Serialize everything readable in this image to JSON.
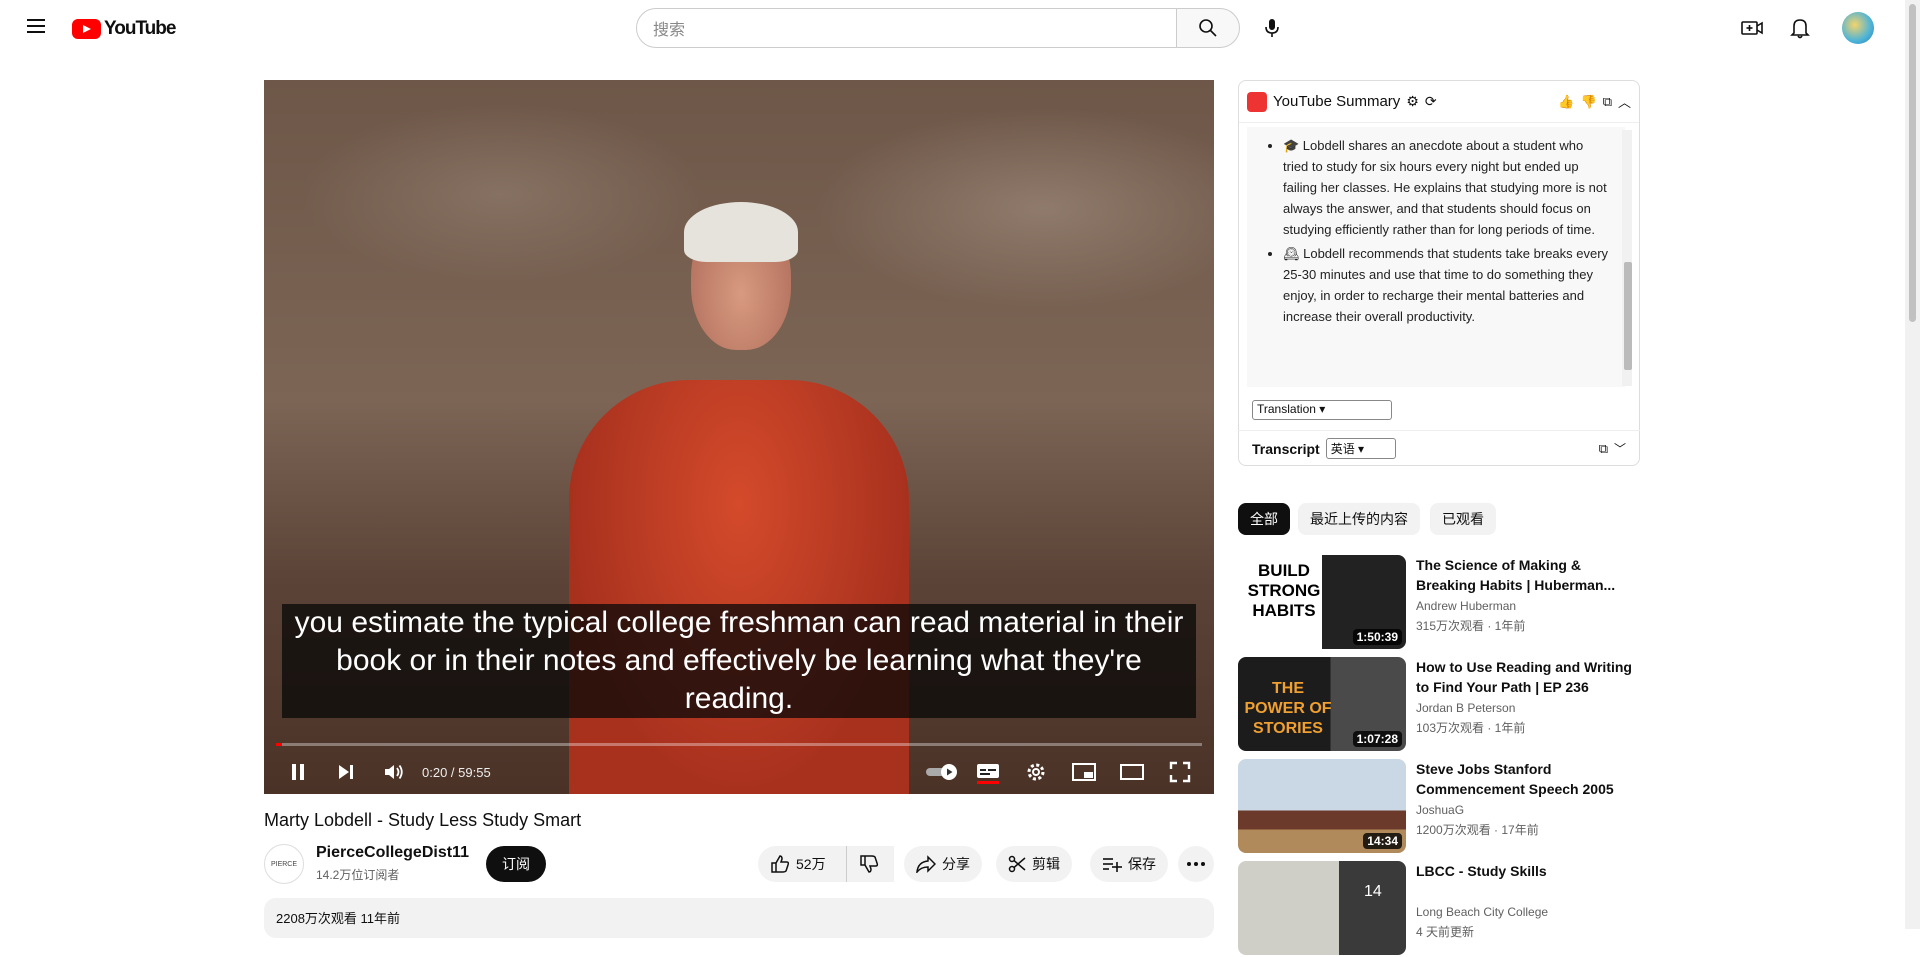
{
  "header": {
    "logo_text": "YouTube",
    "search_placeholder": "搜索"
  },
  "player": {
    "subtitle": "you estimate the typical college freshman can read material in their book or in their notes and effectively be learning what they're reading.",
    "time": "0:20 / 59:55",
    "progress_fraction": 0.006
  },
  "video": {
    "title": "Marty Lobdell - Study Less Study Smart",
    "channel_logo_text": "PIERCE COLLEGE",
    "channel_name": "PierceCollegeDist11",
    "subscribers": "14.2万位订阅者",
    "subscribe_label": "订阅",
    "likes": "52万",
    "share_label": "分享",
    "clip_label": "剪辑",
    "save_label": "保存",
    "views_date": "2208万次观看  11年前"
  },
  "summary": {
    "title": "YouTube Summary",
    "bullets": [
      "🎓 Lobdell shares an anecdote about a student who tried to study for six hours every night but ended up failing her classes. He explains that studying more is not always the answer, and that students should focus on studying efficiently rather than for long periods of time.",
      "🕰 Lobdell recommends that students take breaks every 25-30 minutes and use that time to do something they enjoy, in order to recharge their mental batteries and increase their overall productivity."
    ],
    "translation_label": "Translation",
    "transcript_label": "Transcript",
    "transcript_lang": "英语"
  },
  "chips": [
    "全部",
    "最近上传的内容",
    "已观看"
  ],
  "recommendations": [
    {
      "title": "The Science of Making & Breaking Habits | Huberman...",
      "channel": "Andrew Huberman",
      "meta": "315万次观看 · 1年前",
      "duration": "1:50:39",
      "thumb_text": "BUILD STRONG HABITS"
    },
    {
      "title": "How to Use Reading and Writing to Find Your Path | EP 236",
      "channel": "Jordan B Peterson",
      "meta": "103万次观看 · 1年前",
      "duration": "1:07:28",
      "thumb_text": "THE POWER OF STORIES"
    },
    {
      "title": "Steve Jobs Stanford Commencement Speech 2005",
      "channel": "JoshuaG",
      "meta": "1200万次观看 · 17年前",
      "duration": "14:34",
      "thumb_text": ""
    },
    {
      "title": "LBCC - Study Skills",
      "channel": "Long Beach City College",
      "meta": "4 天前更新",
      "duration": "14",
      "thumb_text": ""
    }
  ]
}
